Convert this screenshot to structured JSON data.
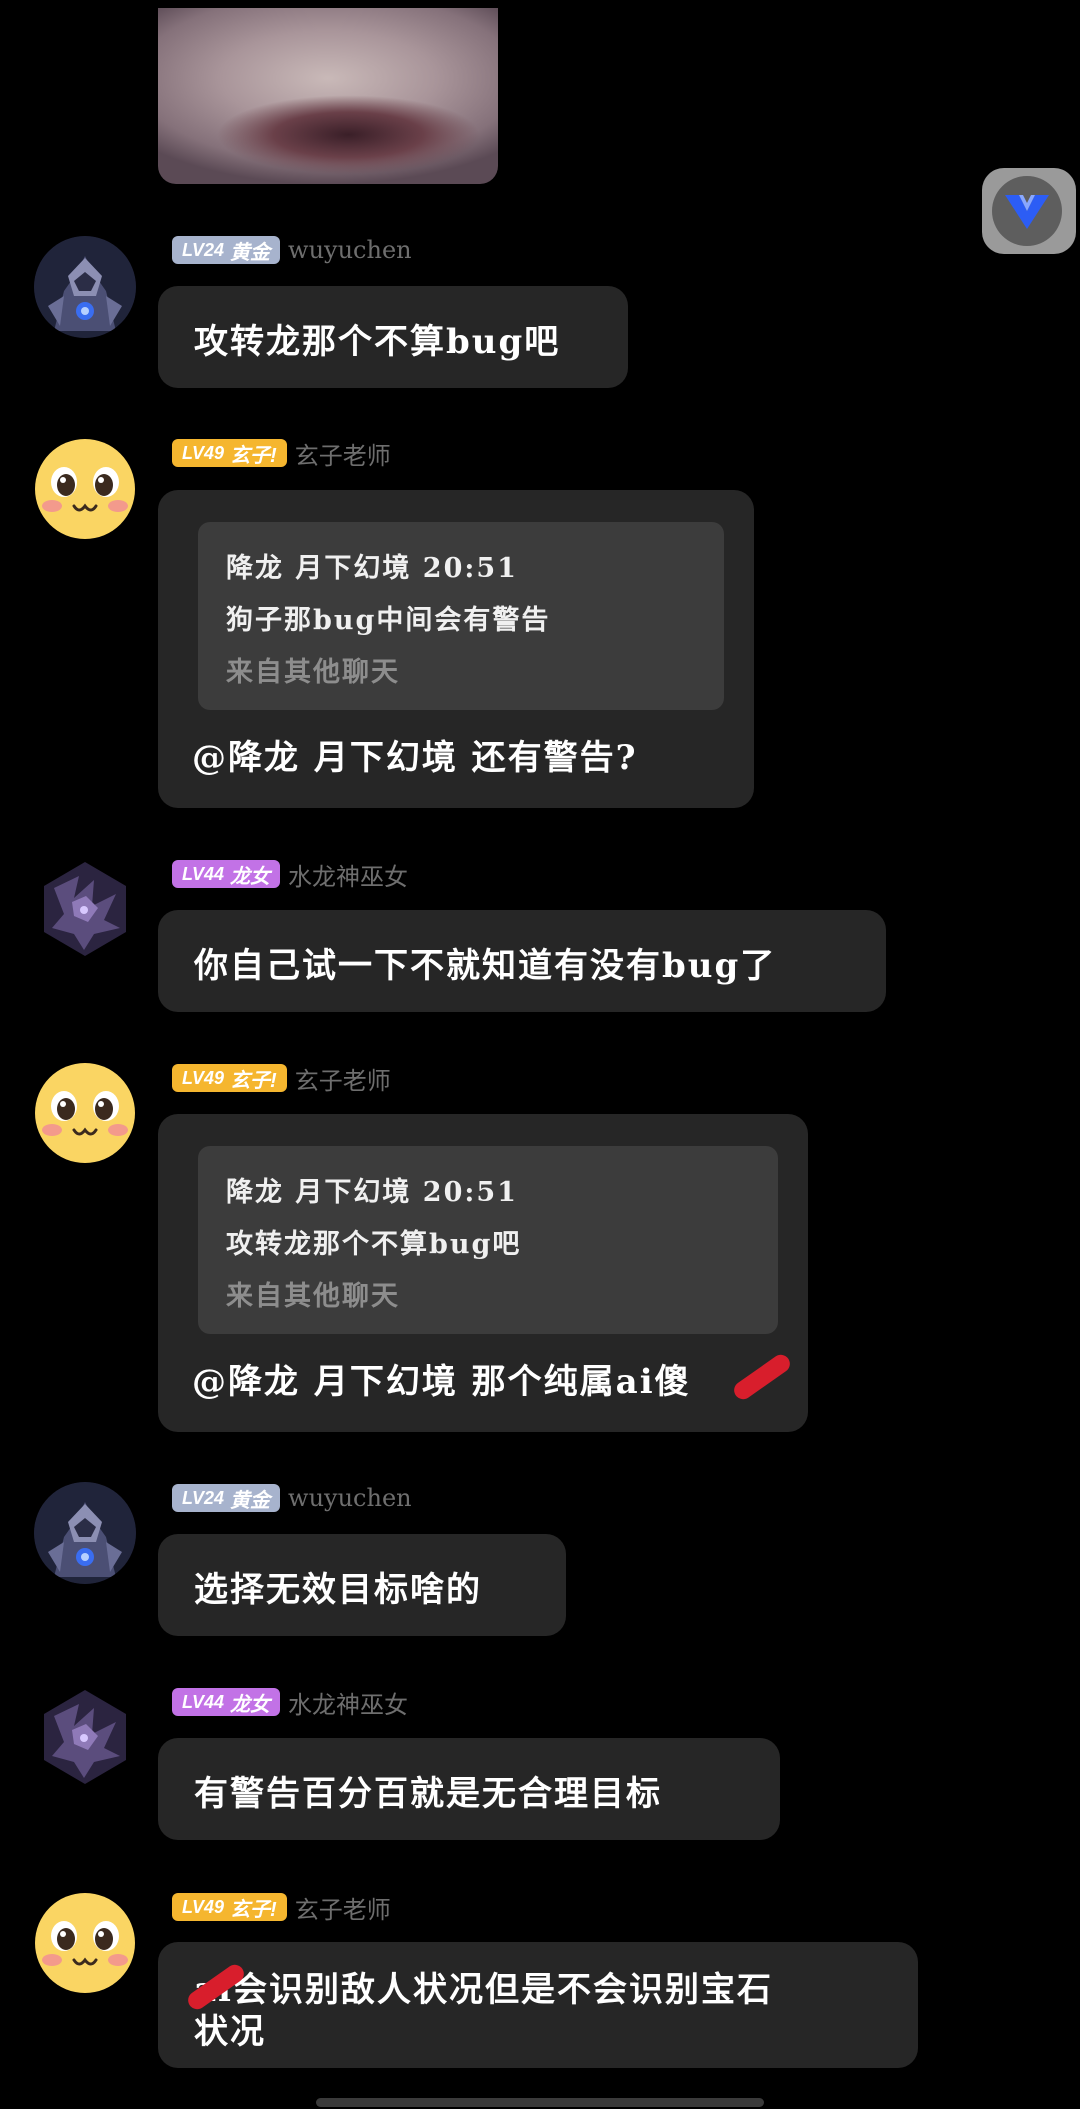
{
  "colors": {
    "background": "#000000",
    "bubble": "#262626",
    "quote": "#3c3c3c",
    "badge_lv24": "#a7b3cd",
    "badge_lv49": "#f5b62f",
    "badge_lv44": "#c272e6"
  },
  "floating_button": {
    "icon": "v-logo-icon"
  },
  "messages": [
    {
      "avatar": "armored-knight-avatar",
      "badge": {
        "level": "LV24",
        "title": "黄金"
      },
      "username": "wuyuchen",
      "text": "攻转龙那个不算bug吧"
    },
    {
      "avatar": "smiley-emoji-avatar",
      "badge": {
        "level": "LV49",
        "title": "玄子!"
      },
      "username": "玄子老师",
      "quote": {
        "header": "降龙 月下幻境 20:51",
        "body": "狗子那bug中间会有警告",
        "source": "来自其他聊天"
      },
      "text": "@降龙 月下幻境 还有警告?"
    },
    {
      "avatar": "purple-dragon-avatar",
      "badge": {
        "level": "LV44",
        "title": "龙女"
      },
      "username": "水龙神巫女",
      "text": "你自己试一下不就知道有没有bug了"
    },
    {
      "avatar": "smiley-emoji-avatar",
      "badge": {
        "level": "LV49",
        "title": "玄子!"
      },
      "username": "玄子老师",
      "quote": {
        "header": "降龙 月下幻境 20:51",
        "body": "攻转龙那个不算bug吧",
        "source": "来自其他聊天"
      },
      "text": "@降龙 月下幻境 那个纯属ai傻"
    },
    {
      "avatar": "armored-knight-avatar",
      "badge": {
        "level": "LV24",
        "title": "黄金"
      },
      "username": "wuyuchen",
      "text": "选择无效目标啥的"
    },
    {
      "avatar": "purple-dragon-avatar",
      "badge": {
        "level": "LV44",
        "title": "龙女"
      },
      "username": "水龙神巫女",
      "text": "有警告百分百就是无合理目标"
    },
    {
      "avatar": "smiley-emoji-avatar",
      "badge": {
        "level": "LV49",
        "title": "玄子!"
      },
      "username": "玄子老师",
      "text_line1": "ai会识别敌人状况但是不会识别宝石",
      "text_line2": "状况"
    }
  ]
}
